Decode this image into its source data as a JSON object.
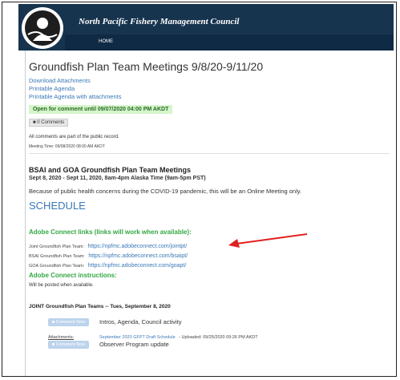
{
  "header": {
    "org_name": "North Pacific Fishery Management Council",
    "nav_home": "HOME"
  },
  "page": {
    "title": "Groundfish Plan Team Meetings 9/8/20-9/11/20",
    "links": [
      "Download Attachments",
      "Printable Agenda",
      "Printable Agenda with attachments"
    ],
    "open_comment": "Open for comment until 09/07/2020 04:00 PM AKDT",
    "comments_button": "0 Comments",
    "public_record_note": "All comments are part of the public record.",
    "meeting_time": "Meeting Time: 09/08/2020 08:00 AM AKDT"
  },
  "meeting": {
    "heading": "BSAI and GOA Groundfish Plan Team Meetings",
    "dates": "Sept 8, 2020 - Sept 11, 2020, 8am-4pm Alaska Time (9am-5pm PST)",
    "notice": "Because of public health concerns during the COVID-19 pandemic, this will be an Online Meeting only.",
    "schedule_label": "SCHEDULE"
  },
  "adobe": {
    "links_heading": "Adobe Connect links (links will work when available):",
    "teams": [
      {
        "label": "Joint Groundfish Plan Team:",
        "url": "https://npfmc.adobeconnect.com/jointpt/"
      },
      {
        "label": "BSAI Groundfish Plan Team:",
        "url": "https://npfmc.adobeconnect.com/bsaipt/"
      },
      {
        "label": "GOA Groundfish Plan Team:",
        "url": "https://npfmc.adobeconnect.com/goapt/"
      }
    ],
    "instructions_heading": "Adobe Connect instructions:",
    "instructions_text": "Will be posted when available."
  },
  "agenda": {
    "day_heading": "JOINT Groundfish Plan Teams -- Tues, September 8, 2020",
    "comment_now_label": "Comment Now",
    "items": [
      {
        "title": "Intros, Agenda, Council activity",
        "attachments_label": "Attachments:",
        "attachment_link": "September 2020 GFPT Draft Schedule",
        "attachment_meta": "- Uploaded: 09/25/2020 09:26 PM AKDT"
      },
      {
        "title": "Observer Program update"
      }
    ]
  },
  "colors": {
    "banner": "#17344f",
    "link": "#3a78b6",
    "accent_green": "#33a844",
    "annotation_arrow": "#e02020"
  }
}
